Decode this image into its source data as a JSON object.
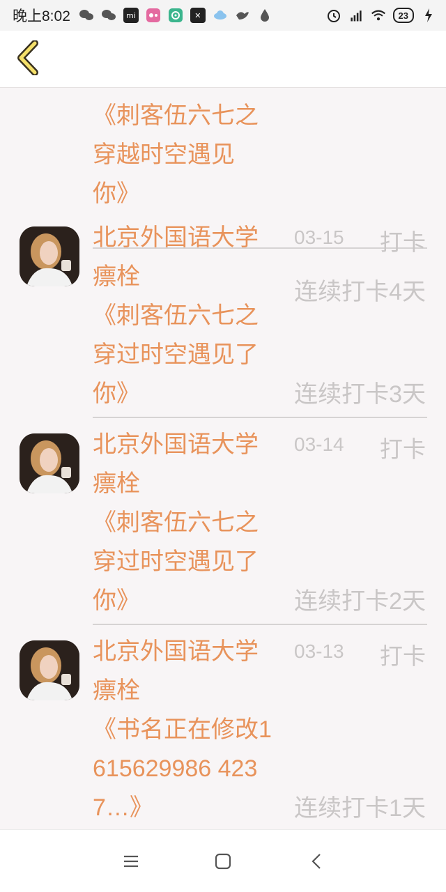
{
  "status_bar": {
    "time": "晚上8:02",
    "battery": "23"
  },
  "header": {
    "back_icon": "chevron-left-icon"
  },
  "partial_entry": {
    "book_lines": [
      "《刺客伍六七之",
      "穿越时空遇见",
      "你》"
    ],
    "streak": "连续打卡4天"
  },
  "entries": [
    {
      "school": "北京外国语大学瘭栓",
      "date": "03-15",
      "status": "打卡",
      "book": "《刺客伍六七之穿过时空遇见了你》",
      "streak": "连续打卡3天"
    },
    {
      "school": "北京外国语大学瘭栓",
      "date": "03-14",
      "status": "打卡",
      "book": "《刺客伍六七之穿过时空遇见了你》",
      "streak": "连续打卡2天"
    },
    {
      "school": "北京外国语大学瘭栓",
      "date": "03-13",
      "status": "打卡",
      "book": "《书名正在修改1615629986 4237…》",
      "streak": "连续打卡1天"
    }
  ],
  "colors": {
    "accent": "#e8935b",
    "muted": "#c9c6c6",
    "back_icon_fill": "#f5e06a"
  }
}
